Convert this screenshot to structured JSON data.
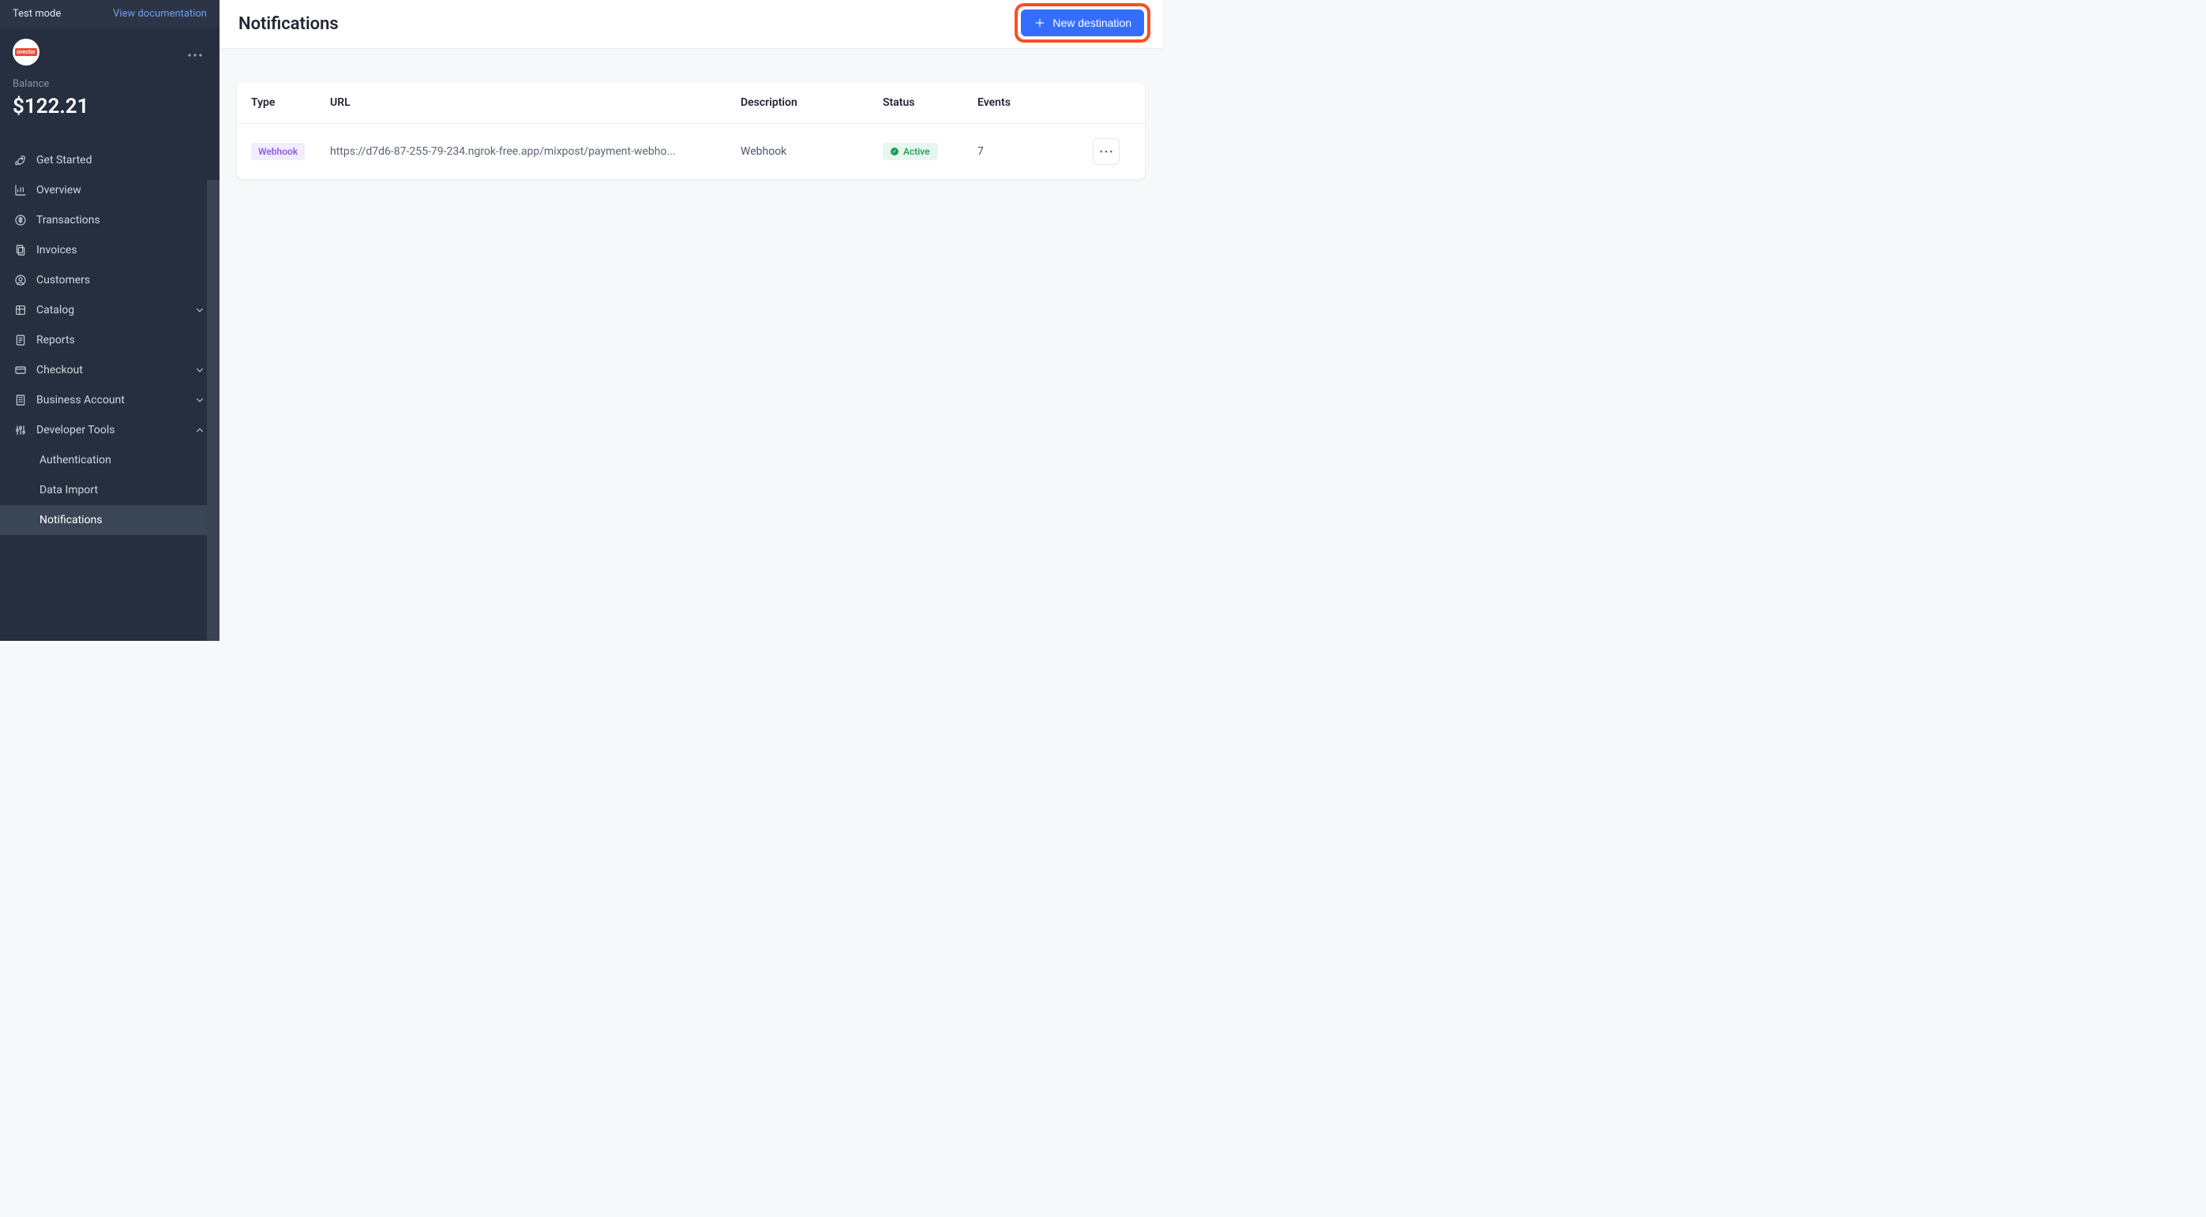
{
  "topbar": {
    "test_mode": "Test mode",
    "view_doc": "View documentation"
  },
  "account": {
    "avatar_text": "ovector"
  },
  "balance": {
    "label": "Balance",
    "amount": "$122.21"
  },
  "nav": {
    "get_started": "Get Started",
    "overview": "Overview",
    "transactions": "Transactions",
    "invoices": "Invoices",
    "customers": "Customers",
    "catalog": "Catalog",
    "reports": "Reports",
    "checkout": "Checkout",
    "business_account": "Business Account",
    "developer_tools": "Developer Tools",
    "authentication": "Authentication",
    "data_import": "Data Import",
    "notifications": "Notifications"
  },
  "header": {
    "title": "Notifications",
    "new_btn": "New destination"
  },
  "table": {
    "headers": {
      "type": "Type",
      "url": "URL",
      "description": "Description",
      "status": "Status",
      "events": "Events"
    },
    "rows": [
      {
        "type_badge": "Webhook",
        "url": "https://d7d6-87-255-79-234.ngrok-free.app/mixpost/payment-webho...",
        "description": "Webhook",
        "status": "Active",
        "events": "7"
      }
    ]
  },
  "colors": {
    "accent": "#356dff",
    "highlight_ring": "#ff4d1f",
    "sidebar_bg": "#252f3f",
    "status_green": "#1d9a5a",
    "type_purple": "#8357e3"
  }
}
